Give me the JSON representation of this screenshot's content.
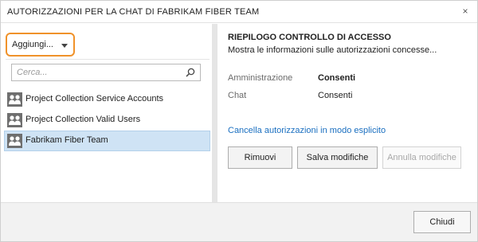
{
  "dialog": {
    "title": "AUTORIZZAZIONI PER LA CHAT DI FABRIKAM FIBER TEAM",
    "close_glyph": "×",
    "close_icon": "close-icon"
  },
  "left": {
    "add_button_label": "Aggiungi...",
    "search_placeholder": "Cerca...",
    "search_icon": "search-icon",
    "group_icon": "group-icon",
    "items": [
      {
        "label": "Project Collection Service Accounts",
        "selected": false
      },
      {
        "label": "Project Collection Valid Users",
        "selected": false
      },
      {
        "label": "Fabrikam Fiber Team",
        "selected": true
      }
    ]
  },
  "right": {
    "title": "RIEPILOGO CONTROLLO DI ACCESSO",
    "subtitle": "Mostra le informazioni sulle autorizzazioni concesse...",
    "permissions": [
      {
        "name": "Amministrazione",
        "value": "Consenti",
        "bold": true
      },
      {
        "name": "Chat",
        "value": "Consenti",
        "bold": false
      }
    ],
    "clear_link": "Cancella autorizzazioni in modo esplicito",
    "buttons": {
      "remove": "Rimuovi",
      "save": "Salva modifiche",
      "undo": "Annulla modifiche"
    }
  },
  "footer": {
    "close_button": "Chiudi"
  },
  "colors": {
    "accent_highlight": "#f0922a",
    "selection_bg": "#cfe3f5",
    "link": "#1a6fc0"
  }
}
